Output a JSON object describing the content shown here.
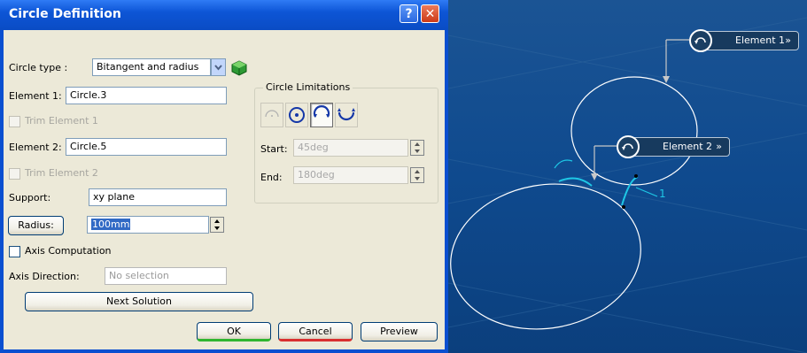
{
  "dialog": {
    "title": "Circle Definition",
    "help_label": "?",
    "close_label": "✕",
    "circle_type": {
      "label": "Circle type :",
      "value": "Bitangent and radius"
    },
    "element1": {
      "label": "Element 1:",
      "value": "Circle.3"
    },
    "trim1": {
      "label": "Trim Element 1",
      "checked": false
    },
    "element2": {
      "label": "Element 2:",
      "value": "Circle.5"
    },
    "trim2": {
      "label": "Trim Element 2",
      "checked": false
    },
    "support": {
      "label": "Support:",
      "value": "xy plane"
    },
    "radius": {
      "label": "Radius:",
      "value": "100mm"
    },
    "axis_computation": {
      "label": "Axis Computation",
      "checked": false
    },
    "axis_direction": {
      "label": "Axis Direction:",
      "value": "No selection"
    },
    "next_solution": "Next Solution",
    "limitations": {
      "title": "Circle Limitations",
      "start": {
        "label": "Start:",
        "value": "45deg"
      },
      "end": {
        "label": "End:",
        "value": "180deg"
      }
    },
    "buttons": {
      "ok": "OK",
      "cancel": "Cancel",
      "preview": "Preview"
    }
  },
  "viewport": {
    "element1_tag": "Element 1",
    "element2_tag": "Element 2",
    "chevron": "»",
    "marker_1": "1",
    "colors": {
      "curve": "#ffffff",
      "accent": "#1ec8e6",
      "background": "#0f4a8e"
    }
  }
}
